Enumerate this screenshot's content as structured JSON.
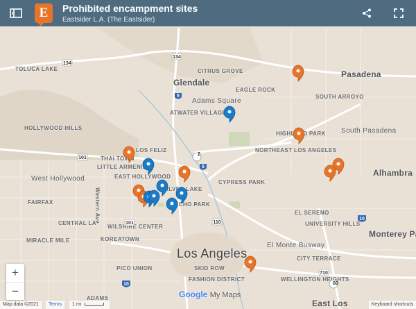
{
  "header": {
    "title": "Prohibited encampment sites",
    "subtitle": "Eastsider L.A. (The Eastsider)",
    "logo_letter": "E",
    "star_glyph": "★"
  },
  "map_labels": {
    "toluca_lake": "TOLUCA LAKE",
    "glendale": "Glendale",
    "citrus_grove": "CITRUS GROVE",
    "eagle_rock": "EAGLE ROCK",
    "adams_square": "Adams Square",
    "pasadena": "Pasadena",
    "south_arroyo": "SOUTH ARROYO",
    "hollywood_hills": "HOLLYWOOD HILLS",
    "atwater_village": "ATWATER VILLAGE",
    "highland_park": "HIGHLAND PARK",
    "south_pasadena": "South Pasadena",
    "northeast_la": "NORTHEAST LOS ANGELES",
    "los_feliz": "LOS FELIZ",
    "thai_town": "THAI TOWN",
    "little_armenia": "LITTLE ARMENIA",
    "east_hollywood": "EAST HOLLYWOOD",
    "west_hollywood": "West Hollywood",
    "fairfax": "FAIRFAX",
    "silver_lake": "SILVER LAKE",
    "cypress_park": "CYPRESS PARK",
    "echo_park": "ECHO PARK",
    "alhambra": "Alhambra",
    "el_sereno": "EL SERENO",
    "western_ave": "Western Ave",
    "central_la": "CENTRAL LA",
    "wilshire_center": "WILSHIRE CENTER",
    "miracle_mile": "MIRACLE MILE",
    "koreatown": "KOREATOWN",
    "university_hills": "UNIVERSITY HILLS",
    "monterey_park": "Monterey Park",
    "los_angeles": "Los Angeles",
    "el_monte_busway": "El Monte Busway",
    "skid_row": "SKID ROW",
    "city_terrace": "CITY TERRACE",
    "pico_union": "PICO UNION",
    "fashion_district": "FASHION DISTRICT",
    "wellington_heights": "WELLINGTON HEIGHTS",
    "east_los": "East Los",
    "adams": "ADAMS",
    "r134": "134",
    "r5": "5",
    "r2": "2",
    "r101": "101",
    "r110": "110",
    "r10": "10",
    "r710": "710",
    "r60": "60"
  },
  "footer": {
    "map_data": "Map data ©2021",
    "terms": "Terms",
    "scale": "1 mi",
    "google": "Google",
    "my_maps": "My Maps",
    "shortcuts": "Keyboard shortcuts"
  },
  "zoom": {
    "in": "+",
    "out": "−"
  },
  "colors": {
    "header": "#4e6b7f",
    "orange_marker": "#e8742a",
    "blue_marker": "#1a7bc9",
    "land": "#e9e1d6",
    "highway": "#ffffff"
  },
  "icons": [
    "panel-toggle-icon",
    "logo-icon",
    "star-icon",
    "share-icon",
    "fullscreen-icon",
    "map-marker-icon"
  ]
}
